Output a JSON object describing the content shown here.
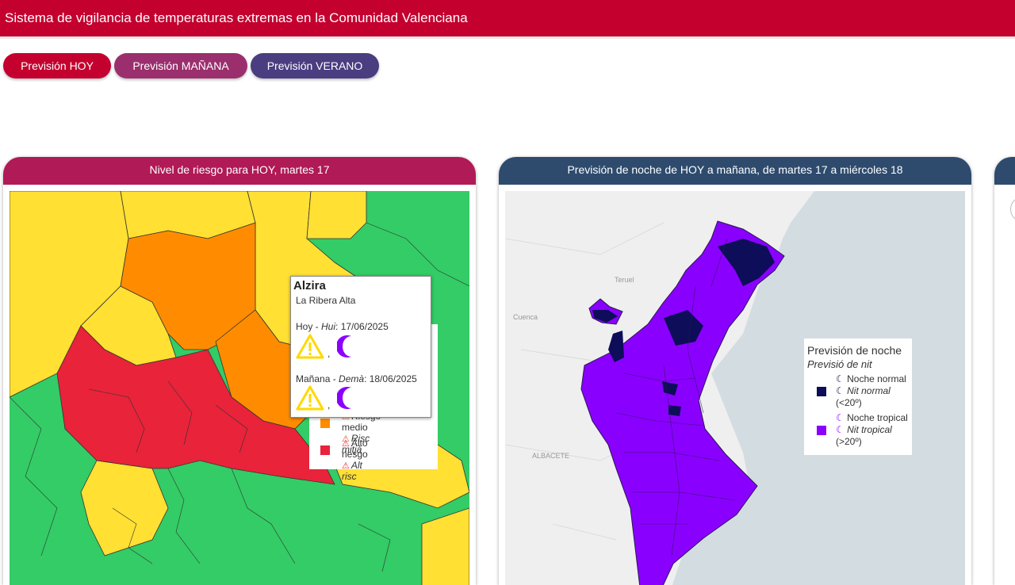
{
  "header": {
    "title": "Sistema de vigilancia de temperaturas extremas en la Comunidad Valenciana"
  },
  "tabs": [
    {
      "label": "Previsión HOY",
      "color": "#c4002f"
    },
    {
      "label": "Previsión MAÑANA",
      "color": "#9b2f6e"
    },
    {
      "label": "Previsión VERANO",
      "color": "#4a3d80"
    }
  ],
  "panel_risk": {
    "title": "Nivel de riesgo para HOY, martes 17",
    "header_color": "#b01a56",
    "legend": {
      "medium_es": "Riesgo medio",
      "medium_va": "Risc mitjà",
      "medium_color": "#ff8c00",
      "high_es": "Alto riesgo",
      "high_va": "Alt risc",
      "high_color": "#e8233a"
    },
    "popup": {
      "place": "Alzira",
      "region": "La Ribera Alta",
      "today_es": "Hoy",
      "today_va": "Hui",
      "today_date": ": 17/06/2025",
      "tomorrow_es": "Mañana",
      "tomorrow_va": "Demà",
      "tomorrow_date": ": 18/06/2025",
      "sep": ",",
      "icons": [
        "warning-triangle-icon",
        "crescent-moon-icon"
      ]
    },
    "colors": {
      "green": "#33cc66",
      "yellow": "#ffe033",
      "orange": "#ff8c00",
      "red": "#e8233a"
    }
  },
  "panel_night": {
    "title": "Previsión de noche de HOY a mañana, de martes 17 a miércoles 18",
    "header_color": "#2e4b6e",
    "map_labels": {
      "teruel": "Teruel",
      "cuenca": "Cuenca",
      "albacete": "ALBACETE"
    },
    "legend": {
      "title_es": "Previsión de noche",
      "title_va": "Previsió de nit",
      "normal_es": "Noche normal",
      "normal_va": "Nit normal",
      "normal_range": "(<20º)",
      "normal_color": "#0d0d5a",
      "tropical_es": "Noche tropical",
      "tropical_va": "Nit tropical",
      "tropical_range": "(>20º)",
      "tropical_color": "#8a00ff"
    }
  }
}
